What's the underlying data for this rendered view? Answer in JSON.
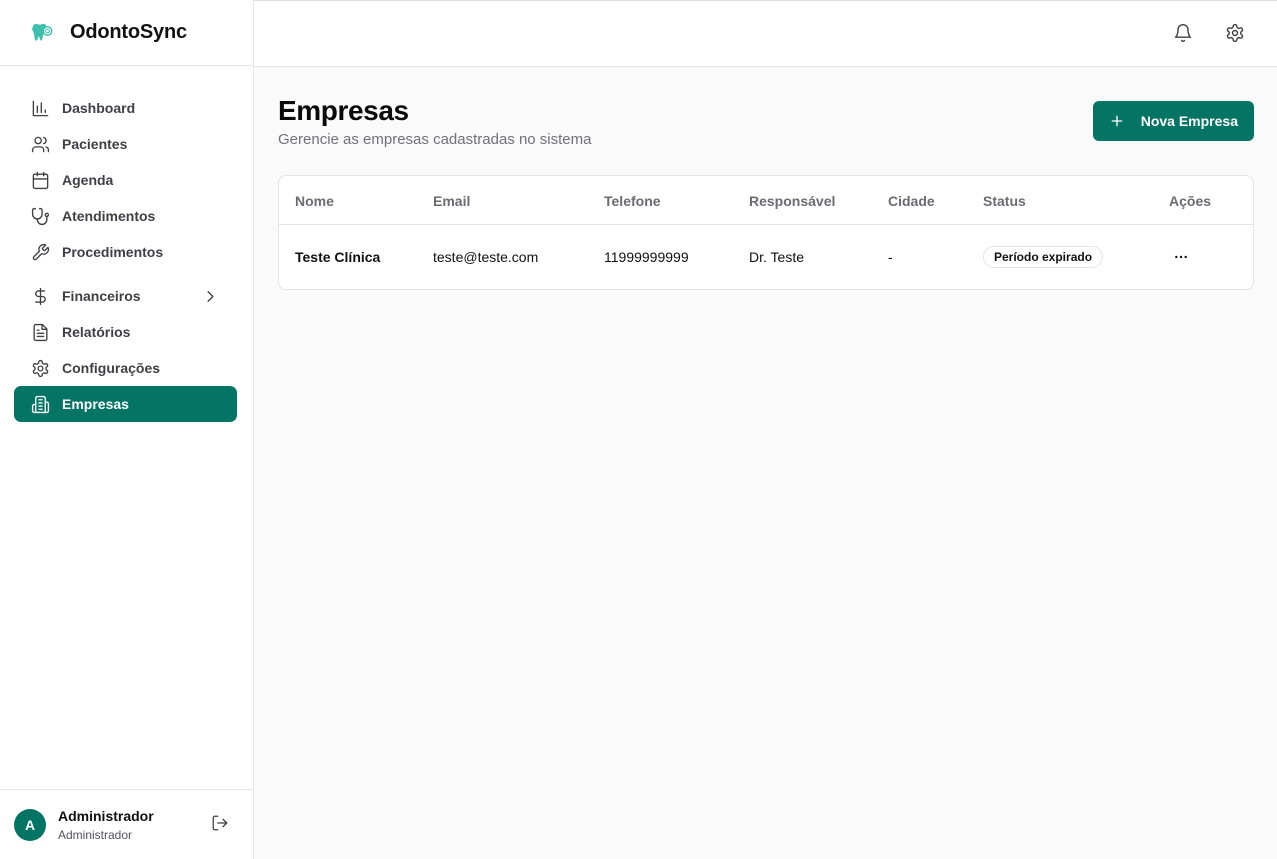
{
  "app": {
    "name": "OdontoSync",
    "logo_icon": "tooth-icon",
    "accent_color": "#047465"
  },
  "sidebar": {
    "items": [
      {
        "label": "Dashboard",
        "icon": "bar-chart-icon"
      },
      {
        "label": "Pacientes",
        "icon": "users-icon"
      },
      {
        "label": "Agenda",
        "icon": "calendar-icon"
      },
      {
        "label": "Atendimentos",
        "icon": "stethoscope-icon"
      },
      {
        "label": "Procedimentos",
        "icon": "wrench-icon"
      },
      {
        "label": "Financeiros",
        "icon": "dollar-icon",
        "has_submenu": true
      },
      {
        "label": "Relatórios",
        "icon": "file-text-icon"
      },
      {
        "label": "Configurações",
        "icon": "gear-icon"
      },
      {
        "label": "Empresas",
        "icon": "building-icon",
        "active": true
      }
    ]
  },
  "user": {
    "initial": "A",
    "name": "Administrador",
    "role": "Administrador"
  },
  "topbar": {
    "icons": [
      "bell-icon",
      "gear-icon"
    ]
  },
  "page": {
    "title": "Empresas",
    "subtitle": "Gerencie as empresas cadastradas no sistema",
    "new_button_label": "Nova Empresa"
  },
  "table": {
    "columns": [
      "Nome",
      "Email",
      "Telefone",
      "Responsável",
      "Cidade",
      "Status",
      "Ações"
    ],
    "rows": [
      {
        "nome": "Teste Clínica",
        "email": "teste@teste.com",
        "telefone": "11999999999",
        "responsavel": "Dr. Teste",
        "cidade": "-",
        "status": "Período expirado"
      }
    ]
  }
}
